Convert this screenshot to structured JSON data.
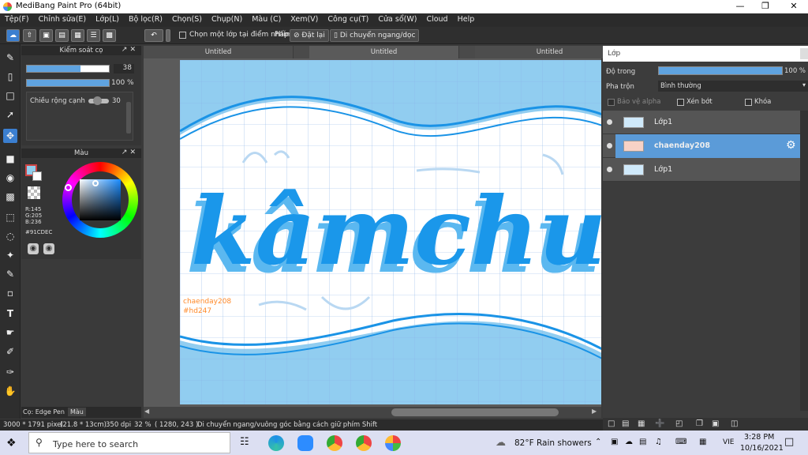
{
  "window": {
    "title": "MediBang Paint Pro (64bit)"
  },
  "menu": [
    "Tệp(F)",
    "Chỉnh sửa(E)",
    "Lớp(L)",
    "Bộ lọc(R)",
    "Chọn(S)",
    "Chụp(N)",
    "Màu (C)",
    "Xem(V)",
    "Công cụ(T)",
    "Cửa sổ(W)",
    "Cloud",
    "Help"
  ],
  "toolbar": {
    "select_layer_label": "Chọn một lớp tại điểm nhấp",
    "keys_label": "Phím",
    "reset_label": "Đặt lại",
    "move_label": "Di chuyển ngang/dọc"
  },
  "brush_panel": {
    "title": "Kiểm soát cọ",
    "size_value": "38",
    "opacity_value": "100 %",
    "opacity": 1.0,
    "size_fraction": 0.65,
    "aa_label": "Chiều rộng cạnh",
    "aa_value": "30"
  },
  "color_panel": {
    "title": "Màu",
    "r": "R:145",
    "g": "G:205",
    "b": "B:236",
    "hex": "#91CDEC",
    "primary_color": "#91CDEC"
  },
  "left_tabs": {
    "brush_tab": "Cọ: Edge Pen",
    "color_tab": "Màu"
  },
  "tabs": [
    "Untitled",
    "Untitled",
    "Untitled"
  ],
  "canvas": {
    "lettering": "kâmchuh",
    "note_line1": "chaenday208",
    "note_line2": "#hd247"
  },
  "layers_panel": {
    "title": "Lớp",
    "opacity_label": "Độ trong",
    "opacity_value": "100 %",
    "blend_label": "Pha trộn",
    "blend_value": "Bình thường",
    "protect_alpha": "Bảo vệ alpha",
    "clip": "Xén bớt",
    "lock": "Khóa",
    "layers": [
      {
        "name": "Lớp1",
        "selected": false
      },
      {
        "name": "chaenday208",
        "selected": true
      },
      {
        "name": "Lớp1",
        "selected": false
      }
    ]
  },
  "status": {
    "size": "3000 * 1791 pixel",
    "dims": "(21.8 * 13cm)",
    "dpi": "350 dpi",
    "zoom": "32 %",
    "coords": "( 1280, 243 )",
    "hint": "Di chuyển ngang/vuông góc bằng cách giữ phím Shift"
  },
  "taskbar": {
    "search_placeholder": "Type here to search",
    "weather": "82°F  Rain showers",
    "lang": "VIE",
    "time": "3:28 PM",
    "date": "10/16/2021"
  }
}
